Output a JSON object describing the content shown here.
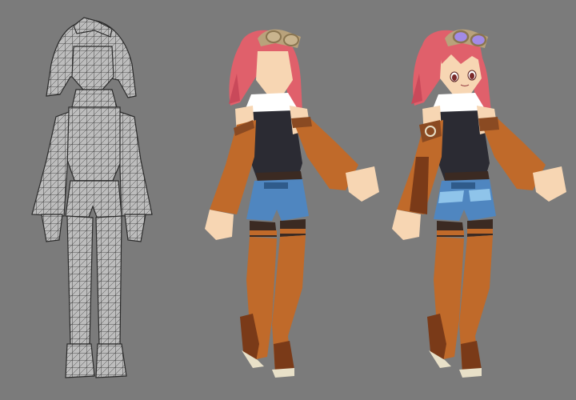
{
  "scene": {
    "background_color": "#7b7b7b",
    "panels": [
      {
        "name": "wireframe-model",
        "shading": "wireframe"
      },
      {
        "name": "flat-color-model",
        "shading": "flat-untextured-face"
      },
      {
        "name": "textured-model",
        "shading": "flat-textured"
      }
    ]
  },
  "colors": {
    "hair": "#e0606b",
    "hair_shadow": "#c9495a",
    "skin": "#f7d6b3",
    "skin_shadow": "#e9bf98",
    "top": "#2b2b33",
    "collar": "#ffffff",
    "sleeve": "#c06a2a",
    "sleeve_dark": "#8a4a22",
    "shorts": "#4f86c0",
    "shorts_light": "#8fc4ea",
    "shorts_dark": "#2f5b8b",
    "belt": "#3b2a22",
    "boots": "#c06a2a",
    "boot_dark": "#7a3a18",
    "boot_sole": "#e8e0c8",
    "goggles": "#b9a27b",
    "goggle_lens": "#a28be6",
    "eye": "#7a2a2a",
    "wire": "#2b2b2b",
    "wire_fill": "#bdbdbd"
  }
}
